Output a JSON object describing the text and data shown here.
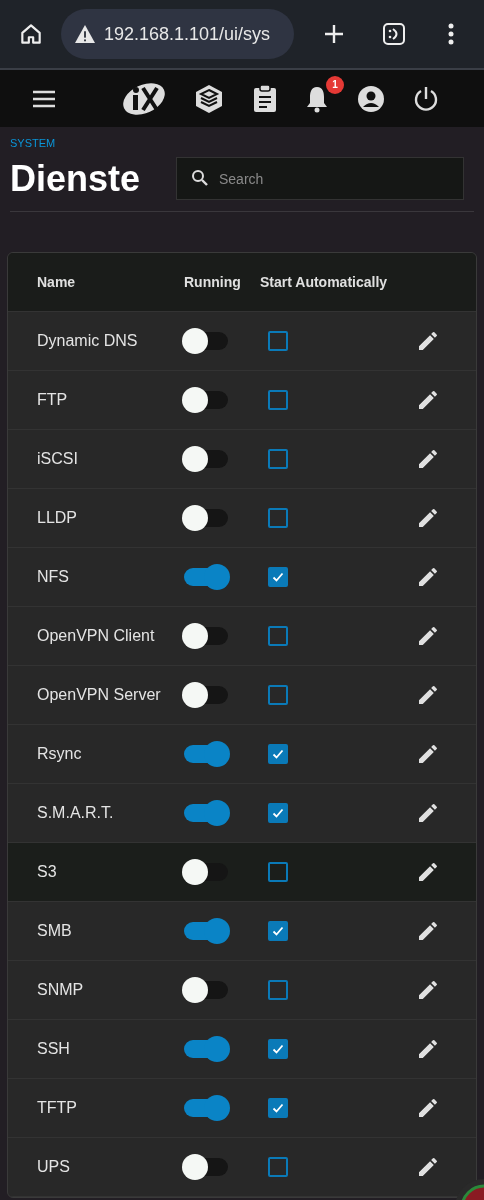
{
  "browser": {
    "url": "192.168.1.101/ui/sys"
  },
  "toolbar": {
    "notification_count": "1"
  },
  "breadcrumb": "SYSTEM",
  "title": "Dienste",
  "search": {
    "placeholder": "Search"
  },
  "table": {
    "columns": [
      "Name",
      "Running",
      "Start Automatically"
    ],
    "rows": [
      {
        "name": "Dynamic DNS",
        "running": false,
        "start_automatically": false,
        "selected": false
      },
      {
        "name": "FTP",
        "running": false,
        "start_automatically": false,
        "selected": false
      },
      {
        "name": "iSCSI",
        "running": false,
        "start_automatically": false,
        "selected": false
      },
      {
        "name": "LLDP",
        "running": false,
        "start_automatically": false,
        "selected": false
      },
      {
        "name": "NFS",
        "running": true,
        "start_automatically": true,
        "selected": false
      },
      {
        "name": "OpenVPN Client",
        "running": false,
        "start_automatically": false,
        "selected": false
      },
      {
        "name": "OpenVPN Server",
        "running": false,
        "start_automatically": false,
        "selected": false
      },
      {
        "name": "Rsync",
        "running": true,
        "start_automatically": true,
        "selected": false
      },
      {
        "name": "S.M.A.R.T.",
        "running": true,
        "start_automatically": true,
        "selected": false
      },
      {
        "name": "S3",
        "running": false,
        "start_automatically": false,
        "selected": true
      },
      {
        "name": "SMB",
        "running": true,
        "start_automatically": true,
        "selected": false
      },
      {
        "name": "SNMP",
        "running": false,
        "start_automatically": false,
        "selected": false
      },
      {
        "name": "SSH",
        "running": true,
        "start_automatically": true,
        "selected": false
      },
      {
        "name": "TFTP",
        "running": true,
        "start_automatically": true,
        "selected": false
      },
      {
        "name": "UPS",
        "running": false,
        "start_automatically": false,
        "selected": false
      }
    ]
  }
}
